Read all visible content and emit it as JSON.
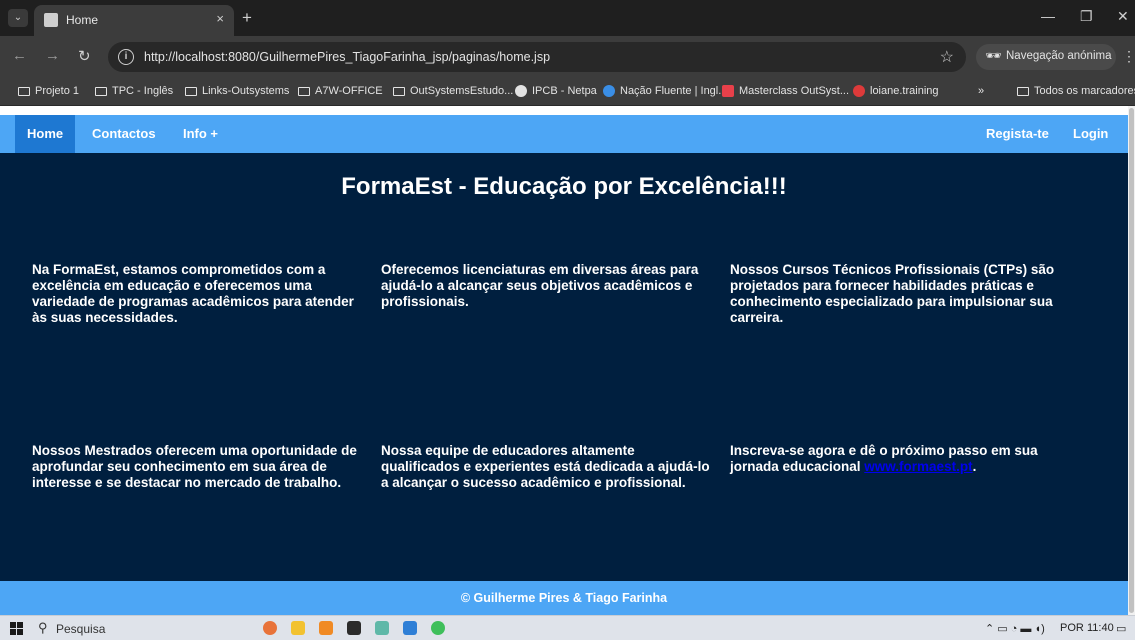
{
  "browser": {
    "tab_title": "Home",
    "tab_close": "×",
    "new_tab": "+",
    "url": "http://localhost:8080/GuilhermePires_TiagoFarinha_jsp/paginas/home.jsp",
    "incognito_label": "Navegação anónima",
    "bookmarks": [
      {
        "label": "Projeto 1"
      },
      {
        "label": "TPC - Inglês"
      },
      {
        "label": "Links-Outsystems"
      },
      {
        "label": "A7W-OFFICE"
      },
      {
        "label": "OutSystemsEstudo..."
      },
      {
        "label": "IPCB - Netpa"
      },
      {
        "label": "Nação Fluente | Ingl..."
      },
      {
        "label": "Masterclass OutSyst..."
      },
      {
        "label": "loiane.training"
      },
      {
        "label": "Todos os marcadores"
      }
    ],
    "bookmarks_overflow": "»"
  },
  "site": {
    "nav_left": [
      {
        "label": "Home"
      },
      {
        "label": "Contactos"
      },
      {
        "label": "Info +"
      }
    ],
    "nav_right": [
      {
        "label": "Regista-te"
      },
      {
        "label": "Login"
      }
    ],
    "headline": "FormaEst - Educação por Excelência!!!",
    "paragraphs": [
      {
        "text": "Na FormaEst, estamos comprometidos com a excelência em educação e oferecemos uma variedade de programas acadêmicos para atender às suas necessidades."
      },
      {
        "text": "Oferecemos licenciaturas em diversas áreas para ajudá-lo a alcançar seus objetivos acadêmicos e profissionais."
      },
      {
        "text": "Nossos Cursos Técnicos Profissionais (CTPs) são projetados para fornecer habilidades práticas e conhecimento especializado para impulsionar sua carreira."
      },
      {
        "text": "Nossos Mestrados oferecem uma oportunidade de aprofundar seu conhecimento em sua área de interesse e se destacar no mercado de trabalho."
      },
      {
        "text": "Nossa equipe de educadores altamente qualificados e experientes está dedicada a ajudá-lo a alcançar o sucesso acadêmico e profissional."
      },
      {
        "text": "Inscreva-se agora e dê o próximo passo em sua jornada educacional ",
        "link": "www.formaest.pt",
        "suffix": "."
      }
    ],
    "footer": "© Guilherme Pires & Tiago Farinha"
  },
  "taskbar": {
    "search_label": "Pesquisa",
    "language": "POR",
    "time": "11:40"
  },
  "colors": {
    "page_bg": "#001f3f",
    "nav_bg": "#4da6f5",
    "nav_active": "#1e78d2",
    "link": "#0000ee"
  }
}
